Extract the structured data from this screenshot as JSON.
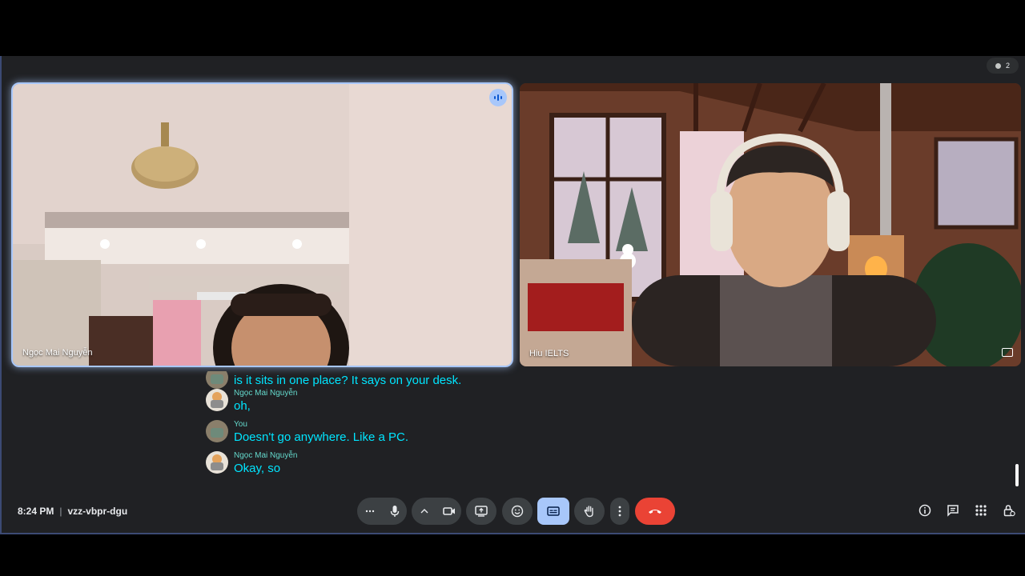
{
  "participants": [
    {
      "name": "Ngọc Mai Nguyễn",
      "speaking": true
    },
    {
      "name": "Hiu IELTS",
      "speaking": false
    }
  ],
  "participant_count": "2",
  "captions": [
    {
      "speaker": "",
      "text": "is it sits in one place? It says on your desk."
    },
    {
      "speaker": "Ngọc Mai Nguyễn",
      "text": "oh,"
    },
    {
      "speaker": "You",
      "text": "Doesn't go anywhere. Like a PC."
    },
    {
      "speaker": "Ngọc Mai Nguyễn",
      "text": "Okay, so"
    }
  ],
  "meeting": {
    "time": "8:24 PM",
    "separator": "|",
    "code": "vzz-vbpr-dgu"
  },
  "colors": {
    "accent": "#a8c7fa",
    "caption": "#00e5ff",
    "end_call": "#ea4335",
    "speaker_name": "#64d8cb"
  },
  "controls": [
    "more-options",
    "microphone",
    "camera-options",
    "camera",
    "present-screen",
    "reactions",
    "captions",
    "raise-hand",
    "more-actions",
    "leave-call"
  ],
  "right_controls": [
    "meeting-details",
    "chat",
    "activities",
    "host-controls"
  ]
}
